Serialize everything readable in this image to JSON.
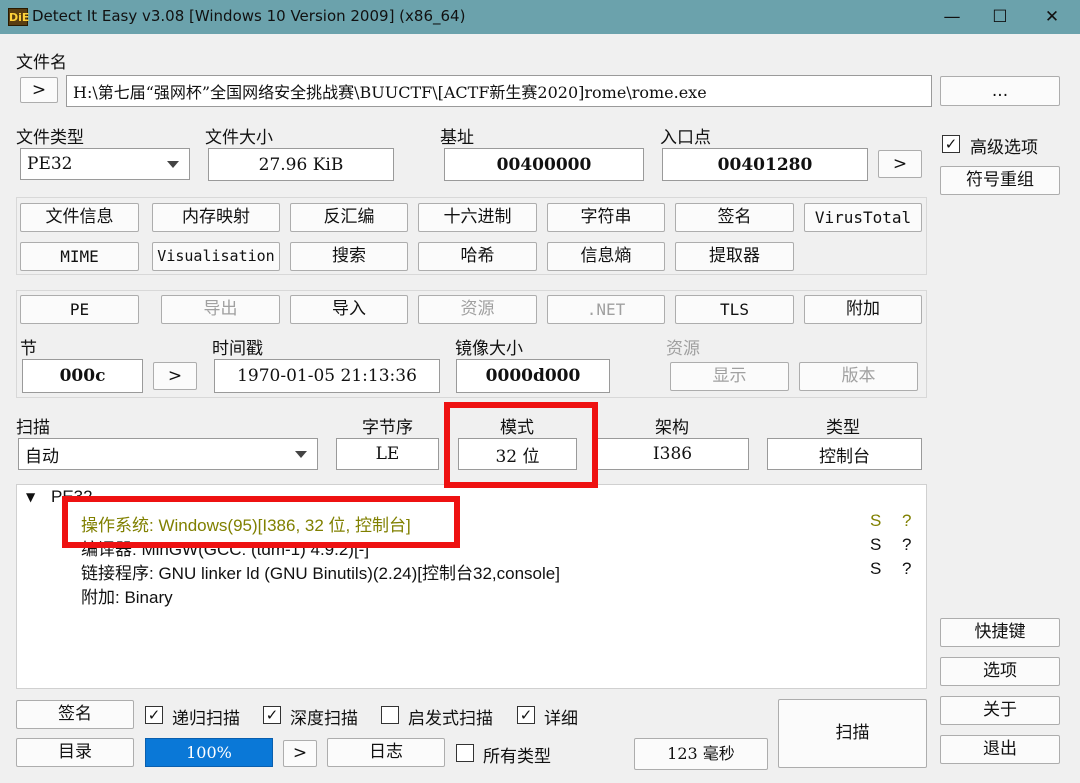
{
  "window": {
    "title": "Detect It Easy v3.08 [Windows 10 Version 2009] (x86_64)",
    "icon_text": "DiE",
    "minimize": "—",
    "maximize": "☐",
    "close": "✕"
  },
  "file": {
    "label": "文件名",
    "nav_button": ">",
    "path": "H:\\第七届“强网杯”全国网络安全挑战赛\\BUUCTF\\[ACTF新生赛2020]rome\\rome.exe",
    "browse_button": "..."
  },
  "info": {
    "file_type_label": "文件类型",
    "file_type_value": "PE32",
    "file_size_label": "文件大小",
    "file_size_value": "27.96 KiB",
    "base_label": "基址",
    "base_value": "00400000",
    "entry_label": "入口点",
    "entry_value": "00401280",
    "entry_nav": ">"
  },
  "options": {
    "advanced_checked": "✓",
    "advanced_label": "高级选项",
    "rebuild_symbols": "符号重组"
  },
  "tools": {
    "row1": [
      "文件信息",
      "内存映射",
      "反汇编",
      "十六进制",
      "字符串",
      "签名",
      "VirusTotal"
    ],
    "row2": [
      "MIME",
      "Visualisation",
      "搜索",
      "哈希",
      "信息熵",
      "提取器"
    ]
  },
  "pe": {
    "buttons": [
      "PE",
      "导出",
      "导入",
      "资源",
      ".NET",
      "TLS",
      "附加"
    ],
    "section_label": "节",
    "section_value": "000c",
    "section_nav": ">",
    "timestamp_label": "时间戳",
    "timestamp_value": "1970-01-05 21:13:36",
    "image_size_label": "镜像大小",
    "image_size_value": "0000d000",
    "resources_label": "资源",
    "show_button": "显示",
    "version_button": "版本"
  },
  "scan": {
    "label": "扫描",
    "mode_value": "自动",
    "endian_label": "字节序",
    "endian_value": "LE",
    "mode_label": "模式",
    "bits_value": "32 位",
    "arch_label": "架构",
    "arch_value": "I386",
    "type_label": "类型",
    "type_value": "控制台"
  },
  "results": {
    "root": "PE32",
    "toggle": "▼",
    "lines": [
      {
        "text": "操作系统: Windows(95)[I386, 32 位, 控制台]",
        "s": "S",
        "q": "?",
        "color": "#808000"
      },
      {
        "text": "编译器: MinGW(GCC: (tdm-1) 4.9.2)[-]",
        "s": "S",
        "q": "?",
        "color": "#111111"
      },
      {
        "text": "链接程序: GNU linker ld (GNU Binutils)(2.24)[控制台32,console]",
        "s": "S",
        "q": "?",
        "color": "#111111"
      },
      {
        "text": "附加: Binary",
        "s": "",
        "q": "",
        "color": "#111111"
      }
    ]
  },
  "side": {
    "shortcuts": "快捷键",
    "options": "选项",
    "about": "关于",
    "exit": "退出"
  },
  "bottom": {
    "signature_button": "签名",
    "recursive_check": "✓",
    "recursive_label": "递归扫描",
    "deep_check": "✓",
    "deep_label": "深度扫描",
    "heuristic_check": "",
    "heuristic_label": "启发式扫描",
    "verbose_check": "✓",
    "verbose_label": "详细",
    "directory_button": "目录",
    "progress_text": "100%",
    "progress_value": 100,
    "nav": ">",
    "log_button": "日志",
    "all_types_check": "",
    "all_types_label": "所有类型",
    "time_button": "123 毫秒",
    "scan_button": "扫描"
  },
  "colors": {
    "titlebar": "#6ba2ac",
    "progress": "#0a78d7",
    "highlight": "#ee1111",
    "os_line": "#808000"
  }
}
